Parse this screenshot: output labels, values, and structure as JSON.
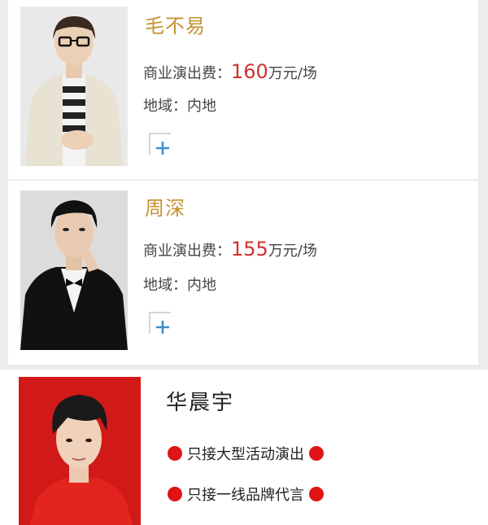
{
  "fee_label": "商业演出费：",
  "region_label": "地域：",
  "artists": [
    {
      "name": "毛不易",
      "fee_value": "160",
      "fee_unit": "万元/场",
      "region": "内地"
    },
    {
      "name": "周深",
      "fee_value": "155",
      "fee_unit": "万元/场",
      "region": "内地"
    }
  ],
  "featured": {
    "name": "华晨宇",
    "notes": [
      "只接大型活动演出",
      "只接一线品牌代言"
    ]
  },
  "colors": {
    "name_gold": "#c79130",
    "price_red": "#d13030",
    "featured_red": "#d11a18",
    "dot_red": "#e01414"
  },
  "icons": {
    "add": "plus-icon",
    "bullet": "red-dot-icon"
  }
}
